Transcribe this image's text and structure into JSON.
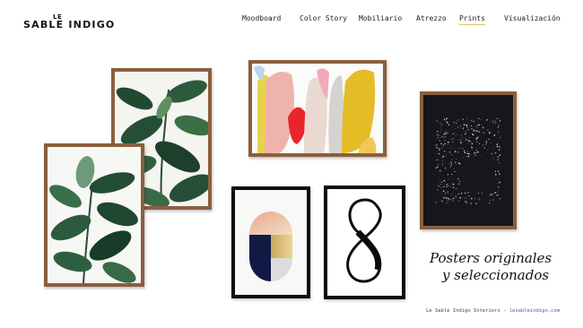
{
  "brand": {
    "le": "LE",
    "name": "SABLE INDIGO"
  },
  "nav": {
    "items": [
      {
        "label": "Moodboard"
      },
      {
        "label": "Color Story"
      },
      {
        "label": "Mobiliario"
      },
      {
        "label": "Atrezzo"
      },
      {
        "label": "Prints",
        "active": true
      },
      {
        "label": "Visualización"
      }
    ]
  },
  "gallery": {
    "prints": [
      {
        "name": "rubber-plant-print-top"
      },
      {
        "name": "rubber-plant-print-bottom"
      },
      {
        "name": "abstract-color-blocks-print"
      },
      {
        "name": "starry-square-print"
      },
      {
        "name": "geometric-oval-print"
      },
      {
        "name": "number-eight-print"
      }
    ]
  },
  "tagline": {
    "line1": "Posters originales",
    "line2": "y seleccionados"
  },
  "footer": {
    "credit": "Le Sable Indigo Interiors -",
    "link": "lesableindigo.com"
  },
  "colors": {
    "accent": "#e3c26a",
    "wood": "#8a5f3e",
    "link": "#3b57c4"
  }
}
